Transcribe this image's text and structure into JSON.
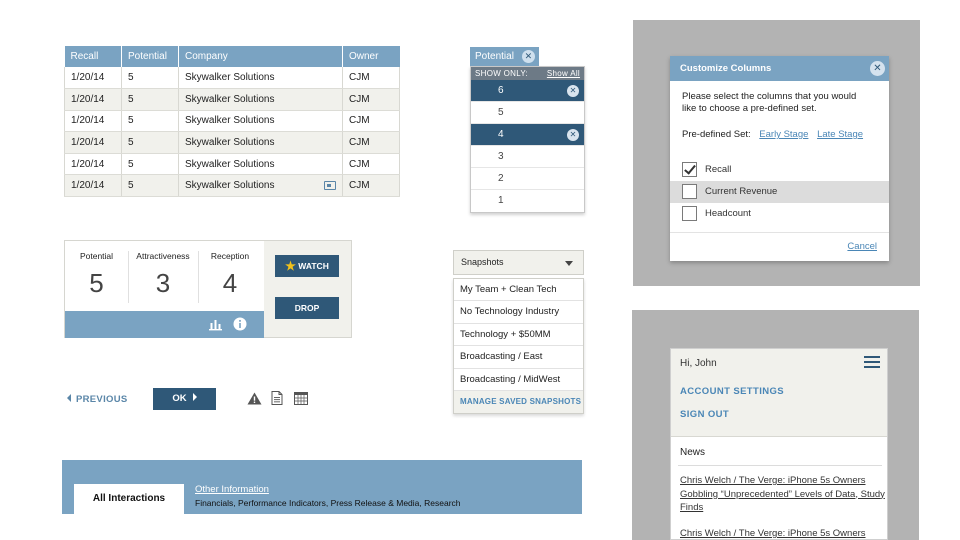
{
  "table": {
    "headers": [
      "Recall",
      "Potential",
      "Company",
      "Owner"
    ],
    "rows": [
      [
        "1/20/14",
        "5",
        "Skywalker Solutions",
        "CJM"
      ],
      [
        "1/20/14",
        "5",
        "Skywalker Solutions",
        "CJM"
      ],
      [
        "1/20/14",
        "5",
        "Skywalker Solutions",
        "CJM"
      ],
      [
        "1/20/14",
        "5",
        "Skywalker Solutions",
        "CJM"
      ],
      [
        "1/20/14",
        "5",
        "Skywalker Solutions",
        "CJM"
      ],
      [
        "1/20/14",
        "5",
        "Skywalker Solutions",
        "CJM"
      ]
    ]
  },
  "potential_filter": {
    "tab_label": "Potential",
    "show_only": "SHOW ONLY:",
    "show_all": "Show All",
    "options": [
      {
        "label": "6",
        "selected": true
      },
      {
        "label": "5",
        "selected": false
      },
      {
        "label": "4",
        "selected": true
      },
      {
        "label": "3",
        "selected": false
      },
      {
        "label": "2",
        "selected": false
      },
      {
        "label": "1",
        "selected": false
      }
    ]
  },
  "scores": {
    "potential_label": "Potential",
    "potential_value": "5",
    "attractiveness_label": "Attractiveness",
    "attractiveness_value": "3",
    "reception_label": "Reception",
    "reception_value": "4",
    "watch_label": "WATCH",
    "drop_label": "DROP"
  },
  "snapshots": {
    "label": "Snapshots",
    "items": [
      "My Team + Clean Tech",
      "No Technology Industry",
      "Technology + $50MM",
      "Broadcasting / East",
      "Broadcasting / MidWest"
    ],
    "manage_label": "MANAGE SAVED SNAPSHOTS"
  },
  "nav": {
    "previous_label": "PREVIOUS",
    "ok_label": "OK"
  },
  "tabs": {
    "active_label": "All Interactions",
    "other_title": "Other Information",
    "other_subtitle": "Financials, Performance Indicators, Press Release & Media, Research"
  },
  "modal": {
    "title": "Customize Columns",
    "description": "Please select the columns that you would like to choose a pre-defined set.",
    "predefined_label": "Pre-defined Set:",
    "early_stage": "Early Stage",
    "late_stage": "Late Stage",
    "columns": [
      {
        "label": "Recall",
        "checked": true
      },
      {
        "label": "Current Revenue",
        "checked": false
      },
      {
        "label": "Headcount",
        "checked": false
      }
    ],
    "cancel_label": "Cancel"
  },
  "mobile": {
    "greeting": "Hi, John",
    "account_settings": "ACCOUNT SETTINGS",
    "sign_out": "SIGN OUT",
    "news_label": "News",
    "article_1": "Chris Welch / The Verge: iPhone 5s Owners Gobbling “Unprecedented” Levels of Data, Study Finds",
    "article_2": "Chris Welch / The Verge: iPhone 5s Owners"
  },
  "colors": {
    "accent_light": "#7aa3c2",
    "accent_dark": "#2f5878",
    "link": "#4a86b6",
    "panel_bg": "#f1f1ec",
    "backdrop": "#b3b3b3",
    "star": "#f2c21b"
  },
  "icons": [
    "card-icon",
    "close-icon",
    "chevron-down-icon",
    "star-icon",
    "bar-chart-icon",
    "info-icon",
    "warning-icon",
    "document-icon",
    "calendar-icon",
    "hamburger-icon",
    "checkmark-icon"
  ]
}
